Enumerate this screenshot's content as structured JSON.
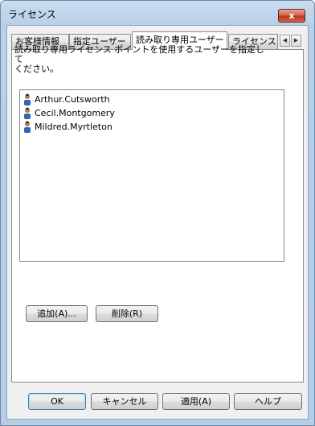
{
  "window": {
    "title": "ライセンス",
    "close_label": "x"
  },
  "tabs": [
    "お客様情報",
    "指定ユーザー",
    "読み取り専用ユーザー",
    "ライセンス ポ"
  ],
  "active_tab_index": 2,
  "panel": {
    "description_line1": "読み取り専用ライセンス ポイントを使用するユーザーを指定して",
    "description_line2": "ください。",
    "users": [
      "Arthur.Cutsworth",
      "Cecil.Montgomery",
      "Mildred.Myrtleton"
    ],
    "add_label": "追加(A)...",
    "delete_label": "削除(R)"
  },
  "footer": {
    "ok": "OK",
    "cancel": "キャンセル",
    "apply": "適用(A)",
    "help": "ヘルプ"
  },
  "colors": {
    "title_bar": "#b9d0e8",
    "close_button": "#c1381f",
    "client_bg": "#f0f0f0"
  }
}
